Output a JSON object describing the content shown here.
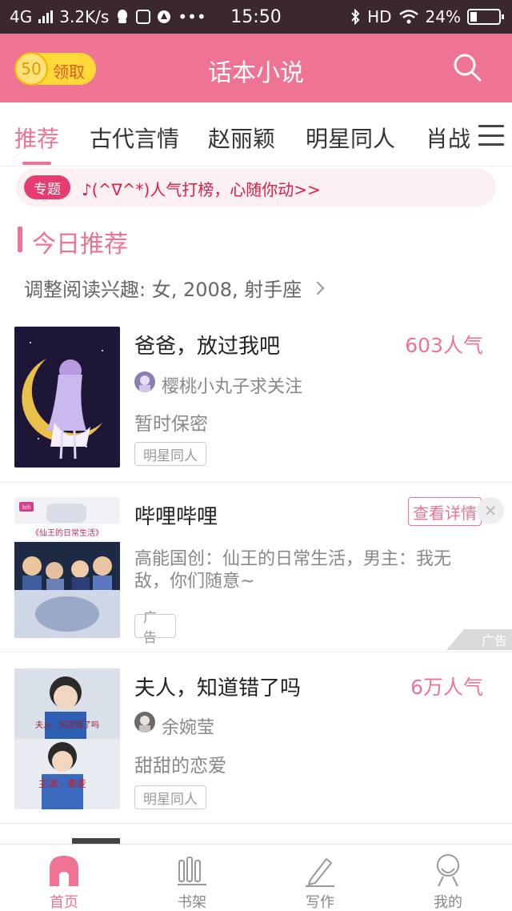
{
  "status_bar": {
    "network": "4G",
    "speed": "3.2K/s",
    "time": "15:50",
    "hd": "HD",
    "battery": "24%",
    "icons": [
      "signal-icon",
      "qq-icon",
      "app-icon",
      "vpn-icon",
      "more-dots-icon",
      "bluetooth-icon",
      "wifi-icon",
      "battery-icon"
    ],
    "more": "•••"
  },
  "header": {
    "coin_value": "50",
    "coin_label": "领取",
    "title": "话本小说",
    "search_icon": "search-icon"
  },
  "tabs": [
    {
      "label": "推荐",
      "active": true
    },
    {
      "label": "古代言情"
    },
    {
      "label": "赵丽颖"
    },
    {
      "label": "明星同人"
    },
    {
      "label": "肖战"
    }
  ],
  "banner": {
    "badge": "专题",
    "text": "♪(^∇^*)人气打榜，心随你动>>"
  },
  "section": {
    "title": "今日推荐",
    "preference": "调整阅读兴趣: 女, 2008, 射手座"
  },
  "items": [
    {
      "title": "爸爸，放过我吧",
      "popularity": "603人气",
      "author": "樱桃小丸子求关注",
      "description": "暂时保密",
      "tag": "明星同人"
    },
    {
      "title": "哔哩哔哩",
      "action": "查看详情",
      "description": "高能国创：仙王的日常生活，男主：我无敌，你们随意~",
      "tag": "广告",
      "ad_mark": "广告",
      "cover_caption": "《仙王的日常生活》",
      "cover_logo": "bili"
    },
    {
      "title": "夫人，知道错了吗",
      "popularity": "6万人气",
      "author": "余婉莹",
      "description": "甜甜的恋爱",
      "tag": "明星同人",
      "cover_caption_1": "夫人，知道错了吗",
      "cover_caption_2": "主演：秦麦"
    }
  ],
  "bottom_nav": [
    {
      "label": "首页",
      "icon": "home-icon",
      "active": true
    },
    {
      "label": "书架",
      "icon": "bookshelf-icon"
    },
    {
      "label": "写作",
      "icon": "pen-icon"
    },
    {
      "label": "我的",
      "icon": "profile-icon"
    }
  ],
  "colors": {
    "accent": "#ef7393",
    "status_bar": "#3a2730",
    "coin": "#ffd83a",
    "banner_text": "#d8204a"
  }
}
